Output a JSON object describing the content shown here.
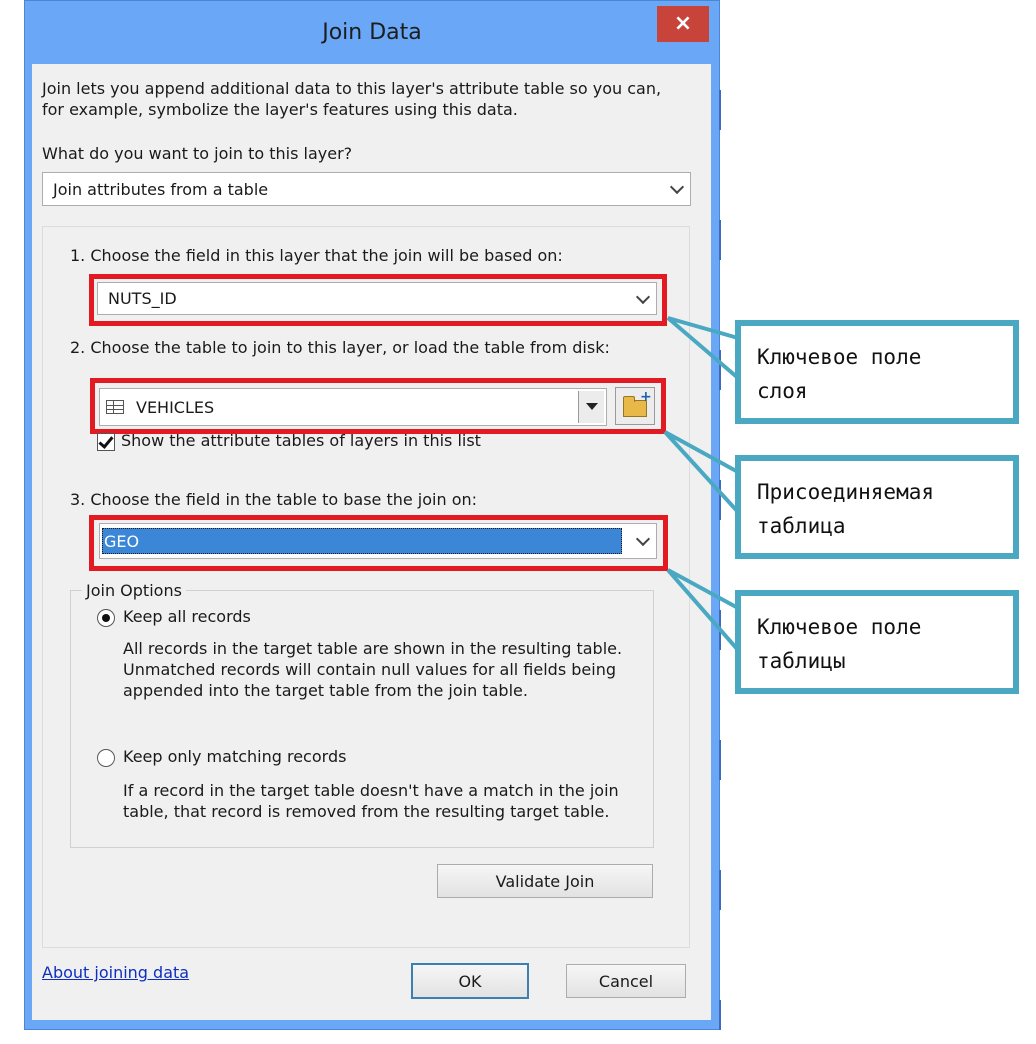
{
  "window": {
    "title": "Join Data",
    "close_glyph": "×"
  },
  "intro": {
    "line1": "Join lets you append additional data to this layer's attribute table so you can,",
    "line2": "for example, symbolize the layer's features using this data."
  },
  "question": "What do you want to join to this layer?",
  "join_type_select": {
    "value": "Join attributes from a table"
  },
  "step1": {
    "label": "1.  Choose the field in this layer that the join will be based on:",
    "value": "NUTS_ID"
  },
  "step2": {
    "label": "2.  Choose the table to join to this layer, or load the table from disk:",
    "value": "VEHICLES",
    "table_icon": "table-icon",
    "browse_icon": "open-folder-icon",
    "show_layers_checkbox": {
      "label": "Show the attribute tables of layers in this list",
      "checked": true
    }
  },
  "step3": {
    "label": "3.  Choose the field in the table to base the join on:",
    "value": "GEO"
  },
  "join_options": {
    "legend": "Join Options",
    "keep_all": {
      "label": "Keep all records",
      "checked": true,
      "desc1": "All records in the target table are shown in the resulting table.",
      "desc2": "Unmatched records will contain null values for all fields being",
      "desc3": "appended into the target table from the join table."
    },
    "keep_matching": {
      "label": "Keep only matching records",
      "checked": false,
      "desc1": "If a record in the target table doesn't have a match in the join",
      "desc2": "table, that record is removed from the resulting target table."
    }
  },
  "buttons": {
    "validate": "Validate Join",
    "ok": "OK",
    "cancel": "Cancel"
  },
  "help_link": "About joining data",
  "callouts": {
    "layer_key_field": {
      "line1": "Ключевое поле",
      "line2": "слоя"
    },
    "joined_table": {
      "line1": "Присоединяемая",
      "line2": "таблица"
    },
    "table_key_field": {
      "line1": "Ключевое поле",
      "line2": "таблицы"
    }
  },
  "colors": {
    "highlight_red": "#e21b22",
    "callout_border": "#4aa8c2",
    "window_blue": "#6aa8f7",
    "selection_blue": "#3b86d6"
  }
}
